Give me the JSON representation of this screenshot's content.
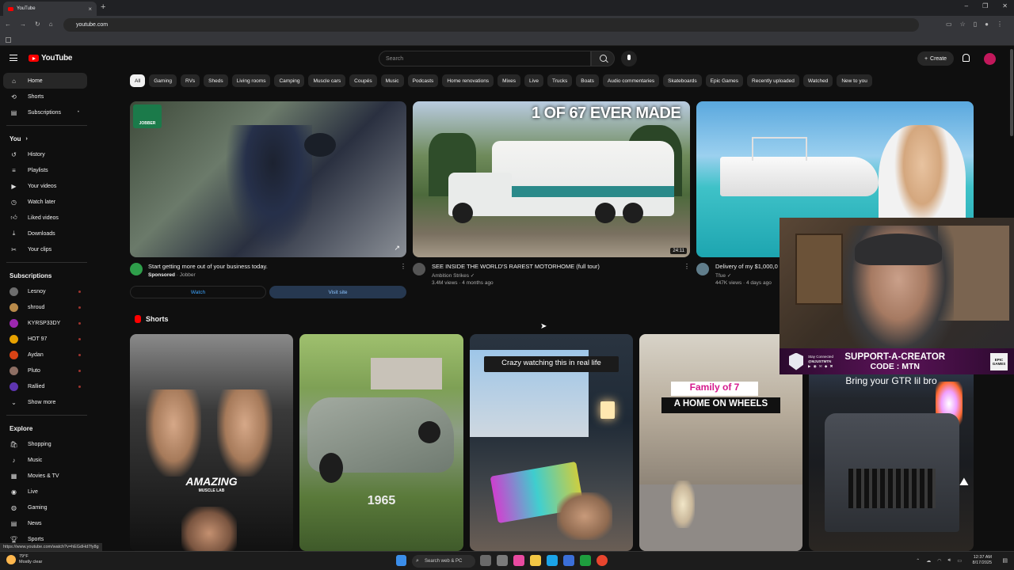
{
  "browser": {
    "tab_title": "YouTube",
    "new_tab": "+",
    "url": "youtube.com",
    "status_url": "https://www.youtube.com/watch?v=hEGdHd7fy8g"
  },
  "header": {
    "logo_text": "YouTube",
    "search_placeholder": "Search",
    "create_label": "Create"
  },
  "sidebar": {
    "main": [
      {
        "label": "Home",
        "icon": "home-icon"
      },
      {
        "label": "Shorts",
        "icon": "shorts-icon"
      },
      {
        "label": "Subscriptions",
        "icon": "subscriptions-icon"
      }
    ],
    "you_heading": "You",
    "you_items": [
      {
        "label": "History"
      },
      {
        "label": "Playlists"
      },
      {
        "label": "Your videos"
      },
      {
        "label": "Watch later"
      },
      {
        "label": "Liked videos"
      },
      {
        "label": "Downloads"
      },
      {
        "label": "Your clips"
      }
    ],
    "subs_heading": "Subscriptions",
    "subs": [
      {
        "label": "Lesnoy",
        "color": "#6d6d6d"
      },
      {
        "label": "shroud",
        "color": "#b88a4a"
      },
      {
        "label": "KYRSP33DY",
        "color": "#9c27b0"
      },
      {
        "label": "HOT 97",
        "color": "#e6a100"
      },
      {
        "label": "Aydan",
        "color": "#d84315"
      },
      {
        "label": "Pluto",
        "color": "#8d6e63"
      },
      {
        "label": "Rallied",
        "color": "#5e35b1"
      }
    ],
    "show_more": "Show more",
    "explore_heading": "Explore",
    "explore": [
      {
        "label": "Shopping"
      },
      {
        "label": "Music"
      },
      {
        "label": "Movies & TV"
      },
      {
        "label": "Live"
      },
      {
        "label": "Gaming"
      },
      {
        "label": "News"
      },
      {
        "label": "Sports"
      }
    ]
  },
  "chips": [
    "All",
    "Gaming",
    "RVs",
    "Sheds",
    "Living rooms",
    "Camping",
    "Muscle cars",
    "Coupés",
    "Music",
    "Podcasts",
    "Home renovations",
    "Mixes",
    "Live",
    "Trucks",
    "Boats",
    "Audio commentaries",
    "Skateboards",
    "Epic Games",
    "Recently uploaded",
    "Watched",
    "New to you"
  ],
  "videos": [
    {
      "title": "Start getting more out of your business today.",
      "sponsored": "Sponsored",
      "channel": "Jobber",
      "watch_btn": "Watch",
      "visit_btn": "Visit site",
      "brand": "JOBBER"
    },
    {
      "title": "SEE INSIDE THE WORLD'S RAREST MOTORHOME (full tour)",
      "channel": "Ambition Strikes",
      "stats": "3.4M views · 4 months ago",
      "overlay": "1 OF 67 EVER MADE",
      "duration": "24:11"
    },
    {
      "title": "Delivery of my $1,000,0",
      "channel": "Tfue",
      "stats": "447K views · 4 days ago"
    }
  ],
  "shorts_label": "Shorts",
  "shorts": [
    {
      "overlay": "AMAZING",
      "sub": "MUSCLE LAB"
    },
    {
      "overlay": "1965"
    },
    {
      "overlay": "Crazy watching this in real life"
    },
    {
      "overlay_line1": "Family of 7",
      "overlay_line2": "A HOME ON WHEELS"
    },
    {
      "overlay": "Bring your GTR lil bro"
    }
  ],
  "stream_banner": {
    "left_small": "Stay Connected",
    "left_handle": "@MJUSTMTN",
    "main": "SUPPORT-A-CREATOR",
    "code": "CODE : MTN",
    "brand": "EPIC GAMES"
  },
  "taskbar": {
    "temp": "79°F",
    "weather": "Mostly clear",
    "search": "Search web & PC",
    "time": "12:37 AM",
    "date": "8/17/2025"
  }
}
